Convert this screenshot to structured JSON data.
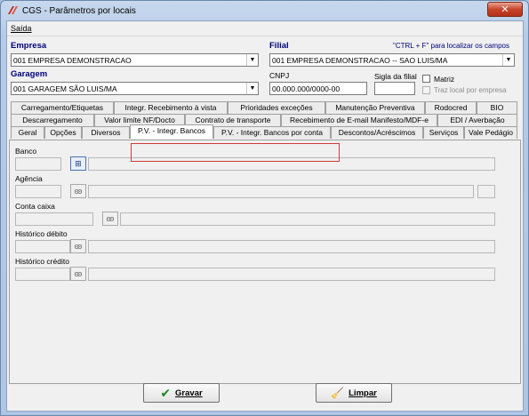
{
  "window": {
    "title": "CGS - Parâmetros por locais",
    "close_symbol": "✕"
  },
  "menu": {
    "items": [
      {
        "label": "Saída"
      }
    ]
  },
  "form": {
    "empresa": {
      "label": "Empresa",
      "value": "001 EMPRESA DEMONSTRACAO"
    },
    "filial": {
      "label": "Filial",
      "value": "001 EMPRESA DEMONSTRACAO -- SAO LUIS/MA"
    },
    "hint": "\"CTRL + F\" para localizar os campos",
    "garagem": {
      "label": "Garagem",
      "value": "001 GARAGEM SÃO LUIS/MA"
    },
    "cnpj": {
      "label": "CNPJ",
      "value": "00.000.000/0000-00"
    },
    "sigla": {
      "label": "Sigla da filial",
      "value": ""
    },
    "matriz": {
      "label": "Matriz",
      "checked": false
    },
    "traz_local": {
      "label": "Traz local por empresa",
      "checked": false
    }
  },
  "tabs": {
    "row1": [
      "Carregamento/Etiquetas",
      "Integr. Recebimento à vista",
      "Prioridades exceções",
      "Manutenção Preventiva",
      "Rodocred",
      "BIO"
    ],
    "row2": [
      "Descarregamento",
      "Valor limite NF/Docto",
      "Contrato de transporte",
      "Recebimento de E-mail Manifesto/MDF-e",
      "EDI / Averbação"
    ],
    "row3": [
      "Geral",
      "Opções",
      "Diversos",
      "P.V. - Integr. Bancos",
      "P.V. - Integr. Bancos por conta",
      "Descontos/Acréscimos",
      "Serviços",
      "Vale Pedágio"
    ],
    "active": "P.V. - Integr. Bancos"
  },
  "panel": {
    "banco": {
      "label": "Banco",
      "code": "",
      "desc": ""
    },
    "agencia": {
      "label": "Agência",
      "code": "",
      "desc": "",
      "extra": ""
    },
    "conta_caixa": {
      "label": "Conta caixa",
      "code": "",
      "desc": ""
    },
    "historico_debito": {
      "label": "Histórico débito",
      "code": "",
      "desc": ""
    },
    "historico_credito": {
      "label": "Histórico crédito",
      "code": "",
      "desc": ""
    }
  },
  "buttons": {
    "gravar": "Gravar",
    "limpar": "Limpar"
  },
  "colors": {
    "label_blue": "#00007a",
    "highlight_red": "#d23a3a",
    "confirm_green": "#1f8a1f"
  }
}
